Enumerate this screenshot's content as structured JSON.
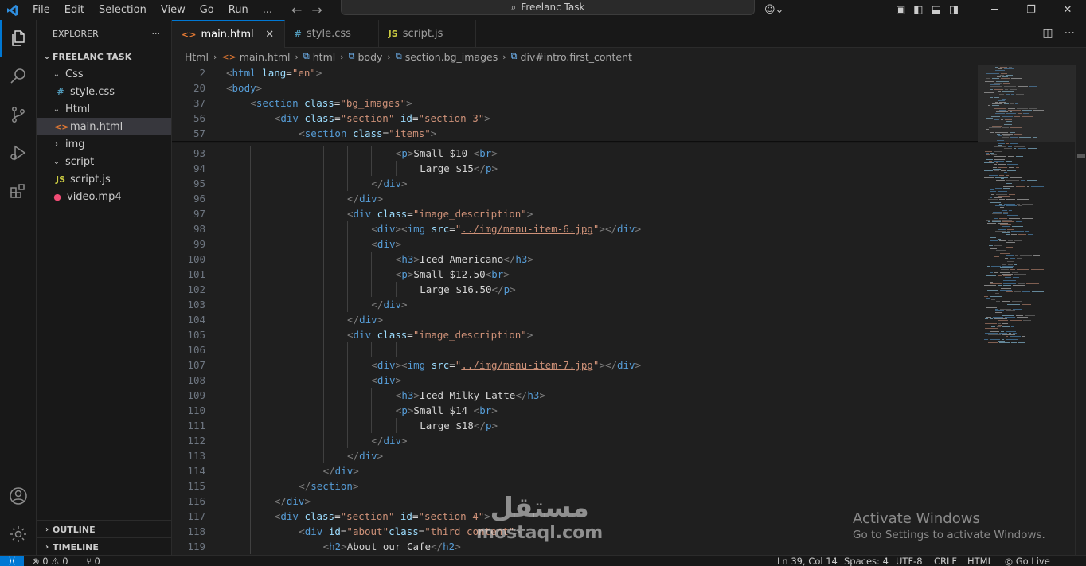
{
  "titlebar": {
    "menu": [
      "File",
      "Edit",
      "Selection",
      "View",
      "Go",
      "Run",
      "..."
    ],
    "search_text": "Freelanc Task"
  },
  "sidebar": {
    "title": "EXPLORER",
    "more": "···",
    "project": "FREELANC TASK",
    "tree": [
      {
        "label": "Css",
        "kind": "folder-open",
        "icon": "",
        "depth": 1
      },
      {
        "label": "style.css",
        "kind": "css",
        "icon": "#",
        "depth": 2
      },
      {
        "label": "Html",
        "kind": "folder-open",
        "icon": "",
        "depth": 1
      },
      {
        "label": "main.html",
        "kind": "html",
        "icon": "<>",
        "depth": 2,
        "selected": true
      },
      {
        "label": "img",
        "kind": "folder",
        "icon": "",
        "depth": 1
      },
      {
        "label": "script",
        "kind": "folder-open",
        "icon": "",
        "depth": 1
      },
      {
        "label": "script.js",
        "kind": "js",
        "icon": "JS",
        "depth": 2
      },
      {
        "label": "video.mp4",
        "kind": "video",
        "icon": "●",
        "depth": 1
      }
    ],
    "outline": "OUTLINE",
    "timeline": "TIMELINE"
  },
  "tabs": [
    {
      "label": "main.html",
      "icon": "<>",
      "active": true,
      "close": "✕"
    },
    {
      "label": "style.css",
      "icon": "#",
      "active": false
    },
    {
      "label": "script.js",
      "icon": "JS",
      "active": false
    }
  ],
  "breadcrumb": [
    "Html",
    "main.html",
    "html",
    "body",
    "section.bg_images",
    "div#intro.first_content"
  ],
  "editor": {
    "sticky": [
      {
        "n": "2",
        "indent": 0,
        "parts": [
          [
            "b",
            "<"
          ],
          [
            "t",
            "html"
          ],
          [
            "x",
            " "
          ],
          [
            "a",
            "lang"
          ],
          [
            "x",
            "="
          ],
          [
            "v",
            "\"en\""
          ],
          [
            "b",
            ">"
          ]
        ]
      },
      {
        "n": "20",
        "indent": 0,
        "parts": [
          [
            "b",
            "<"
          ],
          [
            "t",
            "body"
          ],
          [
            "b",
            ">"
          ]
        ]
      },
      {
        "n": "37",
        "indent": 4,
        "parts": [
          [
            "b",
            "<"
          ],
          [
            "t",
            "section"
          ],
          [
            "x",
            " "
          ],
          [
            "a",
            "class"
          ],
          [
            "x",
            "="
          ],
          [
            "v",
            "\"bg_images\""
          ],
          [
            "b",
            ">"
          ]
        ]
      },
      {
        "n": "56",
        "indent": 8,
        "parts": [
          [
            "b",
            "<"
          ],
          [
            "t",
            "div"
          ],
          [
            "x",
            " "
          ],
          [
            "a",
            "class"
          ],
          [
            "x",
            "="
          ],
          [
            "v",
            "\"section\""
          ],
          [
            "x",
            " "
          ],
          [
            "a",
            "id"
          ],
          [
            "x",
            "="
          ],
          [
            "v",
            "\"section-3\""
          ],
          [
            "b",
            ">"
          ]
        ]
      },
      {
        "n": "57",
        "indent": 12,
        "parts": [
          [
            "b",
            "<"
          ],
          [
            "t",
            "section"
          ],
          [
            "x",
            " "
          ],
          [
            "a",
            "class"
          ],
          [
            "x",
            "="
          ],
          [
            "v",
            "\"items\""
          ],
          [
            "b",
            ">"
          ]
        ]
      }
    ],
    "lines": [
      {
        "n": "93",
        "indent": 28,
        "parts": [
          [
            "b",
            "<"
          ],
          [
            "t",
            "p"
          ],
          [
            "b",
            ">"
          ],
          [
            "x",
            "Small $10 "
          ],
          [
            "b",
            "<"
          ],
          [
            "t",
            "br"
          ],
          [
            "b",
            ">"
          ]
        ]
      },
      {
        "n": "94",
        "indent": 32,
        "parts": [
          [
            "x",
            "Large $15"
          ],
          [
            "b",
            "</"
          ],
          [
            "t",
            "p"
          ],
          [
            "b",
            ">"
          ]
        ]
      },
      {
        "n": "95",
        "indent": 24,
        "parts": [
          [
            "b",
            "</"
          ],
          [
            "t",
            "div"
          ],
          [
            "b",
            ">"
          ]
        ]
      },
      {
        "n": "96",
        "indent": 20,
        "parts": [
          [
            "b",
            "</"
          ],
          [
            "t",
            "div"
          ],
          [
            "b",
            ">"
          ]
        ]
      },
      {
        "n": "97",
        "indent": 20,
        "parts": [
          [
            "b",
            "<"
          ],
          [
            "t",
            "div"
          ],
          [
            "x",
            " "
          ],
          [
            "a",
            "class"
          ],
          [
            "x",
            "="
          ],
          [
            "v",
            "\"image_description\""
          ],
          [
            "b",
            ">"
          ]
        ]
      },
      {
        "n": "98",
        "indent": 24,
        "parts": [
          [
            "b",
            "<"
          ],
          [
            "t",
            "div"
          ],
          [
            "b",
            "><"
          ],
          [
            "t",
            "img"
          ],
          [
            "x",
            " "
          ],
          [
            "a",
            "src"
          ],
          [
            "x",
            "="
          ],
          [
            "v",
            "\""
          ],
          [
            "u",
            "../img/menu-item-6.jpg"
          ],
          [
            "v",
            "\""
          ],
          [
            "b",
            "></"
          ],
          [
            "t",
            "div"
          ],
          [
            "b",
            ">"
          ]
        ]
      },
      {
        "n": "99",
        "indent": 24,
        "parts": [
          [
            "b",
            "<"
          ],
          [
            "t",
            "div"
          ],
          [
            "b",
            ">"
          ]
        ]
      },
      {
        "n": "100",
        "indent": 28,
        "parts": [
          [
            "b",
            "<"
          ],
          [
            "t",
            "h3"
          ],
          [
            "b",
            ">"
          ],
          [
            "x",
            "Iced Americano"
          ],
          [
            "b",
            "</"
          ],
          [
            "t",
            "h3"
          ],
          [
            "b",
            ">"
          ]
        ]
      },
      {
        "n": "101",
        "indent": 28,
        "parts": [
          [
            "b",
            "<"
          ],
          [
            "t",
            "p"
          ],
          [
            "b",
            ">"
          ],
          [
            "x",
            "Small $12.50"
          ],
          [
            "b",
            "<"
          ],
          [
            "t",
            "br"
          ],
          [
            "b",
            ">"
          ]
        ]
      },
      {
        "n": "102",
        "indent": 32,
        "parts": [
          [
            "x",
            "Large $16.50"
          ],
          [
            "b",
            "</"
          ],
          [
            "t",
            "p"
          ],
          [
            "b",
            ">"
          ]
        ]
      },
      {
        "n": "103",
        "indent": 24,
        "parts": [
          [
            "b",
            "</"
          ],
          [
            "t",
            "div"
          ],
          [
            "b",
            ">"
          ]
        ]
      },
      {
        "n": "104",
        "indent": 20,
        "parts": [
          [
            "b",
            "</"
          ],
          [
            "t",
            "div"
          ],
          [
            "b",
            ">"
          ]
        ]
      },
      {
        "n": "105",
        "indent": 20,
        "parts": [
          [
            "b",
            "<"
          ],
          [
            "t",
            "div"
          ],
          [
            "x",
            " "
          ],
          [
            "a",
            "class"
          ],
          [
            "x",
            "="
          ],
          [
            "v",
            "\"image_description\""
          ],
          [
            "b",
            ">"
          ]
        ]
      },
      {
        "n": "106",
        "indent": 0,
        "parts": []
      },
      {
        "n": "107",
        "indent": 24,
        "parts": [
          [
            "b",
            "<"
          ],
          [
            "t",
            "div"
          ],
          [
            "b",
            "><"
          ],
          [
            "t",
            "img"
          ],
          [
            "x",
            " "
          ],
          [
            "a",
            "src"
          ],
          [
            "x",
            "="
          ],
          [
            "v",
            "\""
          ],
          [
            "u",
            "../img/menu-item-7.jpg"
          ],
          [
            "v",
            "\""
          ],
          [
            "b",
            "></"
          ],
          [
            "t",
            "div"
          ],
          [
            "b",
            ">"
          ]
        ]
      },
      {
        "n": "108",
        "indent": 24,
        "parts": [
          [
            "b",
            "<"
          ],
          [
            "t",
            "div"
          ],
          [
            "b",
            ">"
          ]
        ]
      },
      {
        "n": "109",
        "indent": 28,
        "parts": [
          [
            "b",
            "<"
          ],
          [
            "t",
            "h3"
          ],
          [
            "b",
            ">"
          ],
          [
            "x",
            "Iced Milky Latte"
          ],
          [
            "b",
            "</"
          ],
          [
            "t",
            "h3"
          ],
          [
            "b",
            ">"
          ]
        ]
      },
      {
        "n": "110",
        "indent": 28,
        "parts": [
          [
            "b",
            "<"
          ],
          [
            "t",
            "p"
          ],
          [
            "b",
            ">"
          ],
          [
            "x",
            "Small $14 "
          ],
          [
            "b",
            "<"
          ],
          [
            "t",
            "br"
          ],
          [
            "b",
            ">"
          ]
        ]
      },
      {
        "n": "111",
        "indent": 32,
        "parts": [
          [
            "x",
            "Large $18"
          ],
          [
            "b",
            "</"
          ],
          [
            "t",
            "p"
          ],
          [
            "b",
            ">"
          ]
        ]
      },
      {
        "n": "112",
        "indent": 24,
        "parts": [
          [
            "b",
            "</"
          ],
          [
            "t",
            "div"
          ],
          [
            "b",
            ">"
          ]
        ]
      },
      {
        "n": "113",
        "indent": 20,
        "parts": [
          [
            "b",
            "</"
          ],
          [
            "t",
            "div"
          ],
          [
            "b",
            ">"
          ]
        ]
      },
      {
        "n": "114",
        "indent": 16,
        "parts": [
          [
            "b",
            "</"
          ],
          [
            "t",
            "div"
          ],
          [
            "b",
            ">"
          ]
        ]
      },
      {
        "n": "115",
        "indent": 12,
        "parts": [
          [
            "b",
            "</"
          ],
          [
            "t",
            "section"
          ],
          [
            "b",
            ">"
          ]
        ]
      },
      {
        "n": "116",
        "indent": 8,
        "parts": [
          [
            "b",
            "</"
          ],
          [
            "t",
            "div"
          ],
          [
            "b",
            ">"
          ]
        ]
      },
      {
        "n": "117",
        "indent": 8,
        "parts": [
          [
            "b",
            "<"
          ],
          [
            "t",
            "div"
          ],
          [
            "x",
            " "
          ],
          [
            "a",
            "class"
          ],
          [
            "x",
            "="
          ],
          [
            "v",
            "\"section\""
          ],
          [
            "x",
            " "
          ],
          [
            "a",
            "id"
          ],
          [
            "x",
            "="
          ],
          [
            "v",
            "\"section-4\""
          ],
          [
            "b",
            ">"
          ]
        ]
      },
      {
        "n": "118",
        "indent": 12,
        "parts": [
          [
            "b",
            "<"
          ],
          [
            "t",
            "div"
          ],
          [
            "x",
            " "
          ],
          [
            "a",
            "id"
          ],
          [
            "x",
            "="
          ],
          [
            "v",
            "\"about\""
          ],
          [
            "a",
            "class"
          ],
          [
            "x",
            "="
          ],
          [
            "v",
            "\"third_content\""
          ],
          [
            "b",
            ">"
          ]
        ]
      },
      {
        "n": "119",
        "indent": 16,
        "parts": [
          [
            "b",
            "<"
          ],
          [
            "t",
            "h2"
          ],
          [
            "b",
            ">"
          ],
          [
            "x",
            "About our Cafe"
          ],
          [
            "b",
            "</"
          ],
          [
            "t",
            "h2"
          ],
          [
            "b",
            ">"
          ]
        ]
      }
    ]
  },
  "watermark": {
    "activate_title": "Activate Windows",
    "activate_sub": "Go to Settings to activate Windows.",
    "brand_arabic": "مستقل",
    "brand_latin": "mostaql.com"
  },
  "statusbar": {
    "problems": "⊗ 0 ⚠ 0",
    "ports": "⑂ 0",
    "position": "Ln 39, Col 14",
    "spaces": "Spaces: 4",
    "encoding": "UTF-8",
    "eol": "CRLF",
    "language": "HTML",
    "golive": "◎ Go Live"
  },
  "colors": {
    "accent": "#0078d4",
    "tag": "#569cd6",
    "attr": "#9cdcfe",
    "string": "#ce9178",
    "bracket": "#808080",
    "text": "#d4d4d4"
  }
}
